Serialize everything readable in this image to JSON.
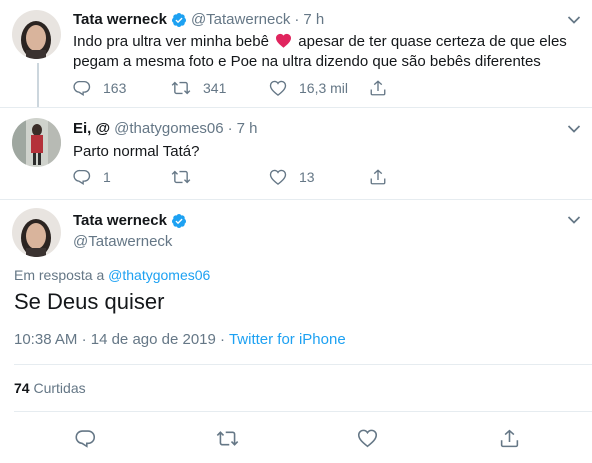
{
  "tweet1": {
    "name": "Tata werneck",
    "handle": "@Tatawerneck",
    "sep": "·",
    "time": "7 h",
    "text_before": "Indo pra ultra ver minha bebê",
    "text_after": " apesar de ter quase certeza de que eles pegam a mesma foto e Poe na ultra dizendo que são bebês diferentes",
    "replies": "163",
    "retweets": "341",
    "likes": "16,3 mil"
  },
  "tweet2": {
    "name": "Ei, @",
    "handle": "@thatygomes06",
    "sep": "·",
    "time": "7 h",
    "text": "Parto normal Tatá?",
    "replies": "1",
    "retweets": "",
    "likes": "13"
  },
  "main": {
    "name": "Tata werneck",
    "handle": "@Tatawerneck",
    "reply_prefix": "Em resposta a",
    "reply_to": "@thatygomes06",
    "text": "Se Deus quiser",
    "time": "10:38 AM",
    "date": "14 de ago de 2019",
    "sep": "·",
    "source": "Twitter for iPhone",
    "likes_count": "74",
    "likes_label": "Curtidas"
  },
  "colors": {
    "link": "#1da1f2",
    "verified": "#1da1f2",
    "heart_emoji": "#e0245e",
    "grey": "#657786"
  },
  "icons": [
    "verified-badge-icon",
    "chevron-down-icon",
    "reply-icon",
    "retweet-icon",
    "like-icon",
    "share-icon",
    "red-heart-emoji"
  ]
}
